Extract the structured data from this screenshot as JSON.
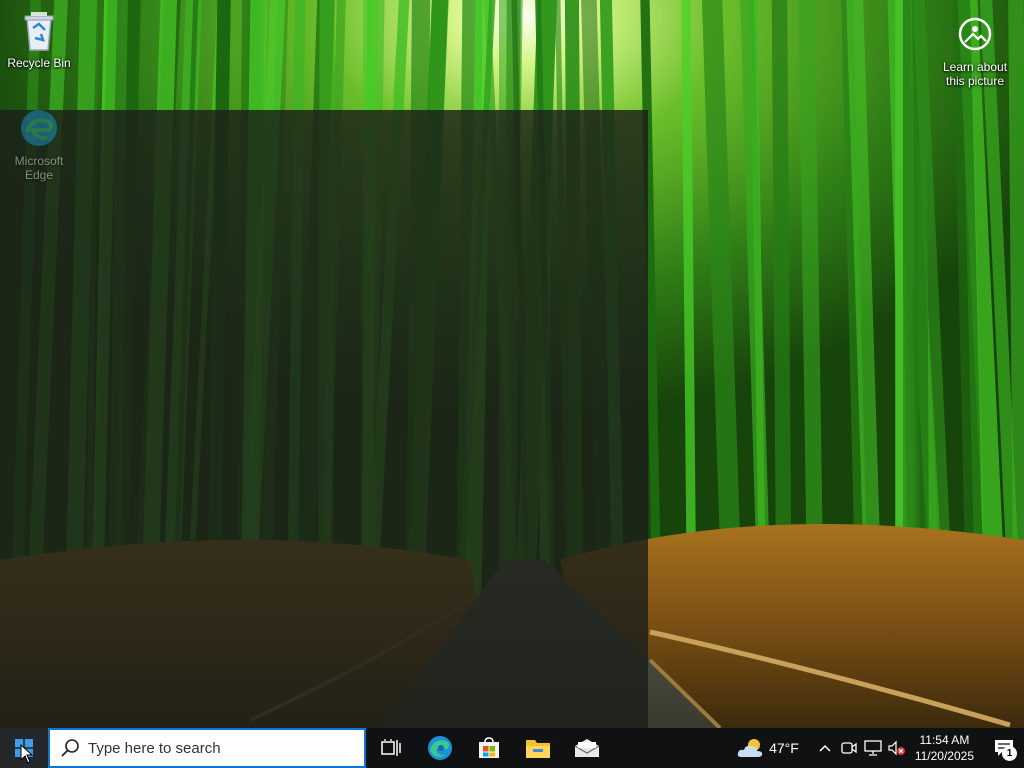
{
  "desktop": {
    "icons": [
      {
        "label": "Recycle Bin",
        "icon": "recycle-bin-icon"
      },
      {
        "label": "Microsoft Edge",
        "icon": "edge-icon"
      },
      {
        "label": "Learn about this picture",
        "icon": "camera-info-icon"
      }
    ],
    "wallpaper": "bamboo-forest"
  },
  "start_menu": {
    "state": "open",
    "content": ""
  },
  "taskbar": {
    "start_icon": "windows-logo-icon",
    "search": {
      "placeholder": "Type here to search",
      "value": ""
    },
    "apps": [
      {
        "name": "Task View",
        "icon": "task-view-icon"
      },
      {
        "name": "Microsoft Edge",
        "icon": "edge-icon"
      },
      {
        "name": "Microsoft Store",
        "icon": "store-icon"
      },
      {
        "name": "File Explorer",
        "icon": "folder-icon"
      },
      {
        "name": "Mail",
        "icon": "mail-icon"
      }
    ],
    "tray": {
      "weather": {
        "temp": "47°F",
        "icon": "partly-cloudy-icon"
      },
      "time": "11:54 AM",
      "date": "11/20/2025",
      "notification_count": "1",
      "icons": [
        "chevron-up-icon",
        "meet-now-icon",
        "network-icon",
        "volume-muted-icon"
      ]
    }
  },
  "colors": {
    "accent": "#0a78d4",
    "taskbar": "#0f1113",
    "panel": "#1c201a"
  }
}
